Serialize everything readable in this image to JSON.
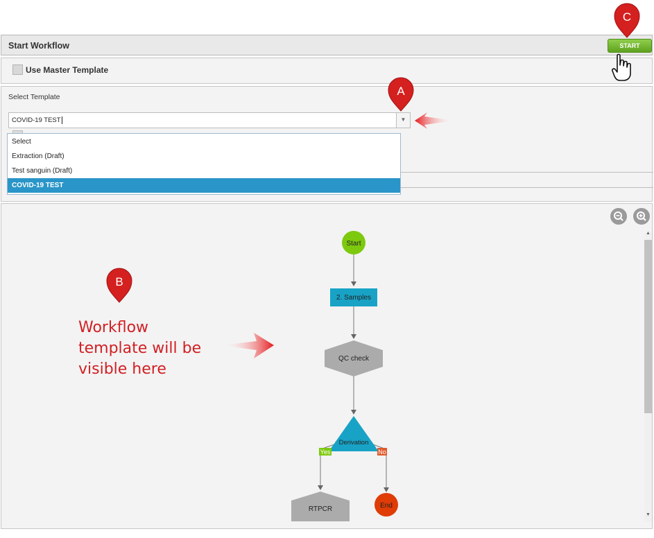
{
  "header": {
    "title": "Start Workflow",
    "start_label": "START"
  },
  "master_template": {
    "label": "Use Master Template"
  },
  "template": {
    "label": "Select Template",
    "value": "COVID-19 TEST",
    "options": [
      "Select",
      "Extraction (Draft)",
      "Test sanguin (Draft)",
      "COVID-19 TEST"
    ],
    "selected_index": 3
  },
  "canvas": {
    "zoom_out_icon": "zoom-out-icon",
    "zoom_in_icon": "zoom-in-icon",
    "nodes": {
      "start": "Start",
      "samples": "2. Samples",
      "qc": "QC check",
      "derivation": "Derivation",
      "rtpcr": "RTPCR",
      "end": "End"
    },
    "branch_yes": "Yes",
    "branch_no": "No"
  },
  "annotation": {
    "callout_a": "A",
    "callout_b": "B",
    "callout_c": "C",
    "text_line1": "Workflow",
    "text_line2": "template will be",
    "text_line3": "visible here"
  },
  "colors": {
    "start_node": "#7dc90e",
    "process_node": "#18a3c6",
    "decision_node": "#18a3c6",
    "qc_node": "#ababab",
    "end_node": "#e03c06",
    "callout": "#d4201f",
    "selected_option": "#2a95c8"
  }
}
